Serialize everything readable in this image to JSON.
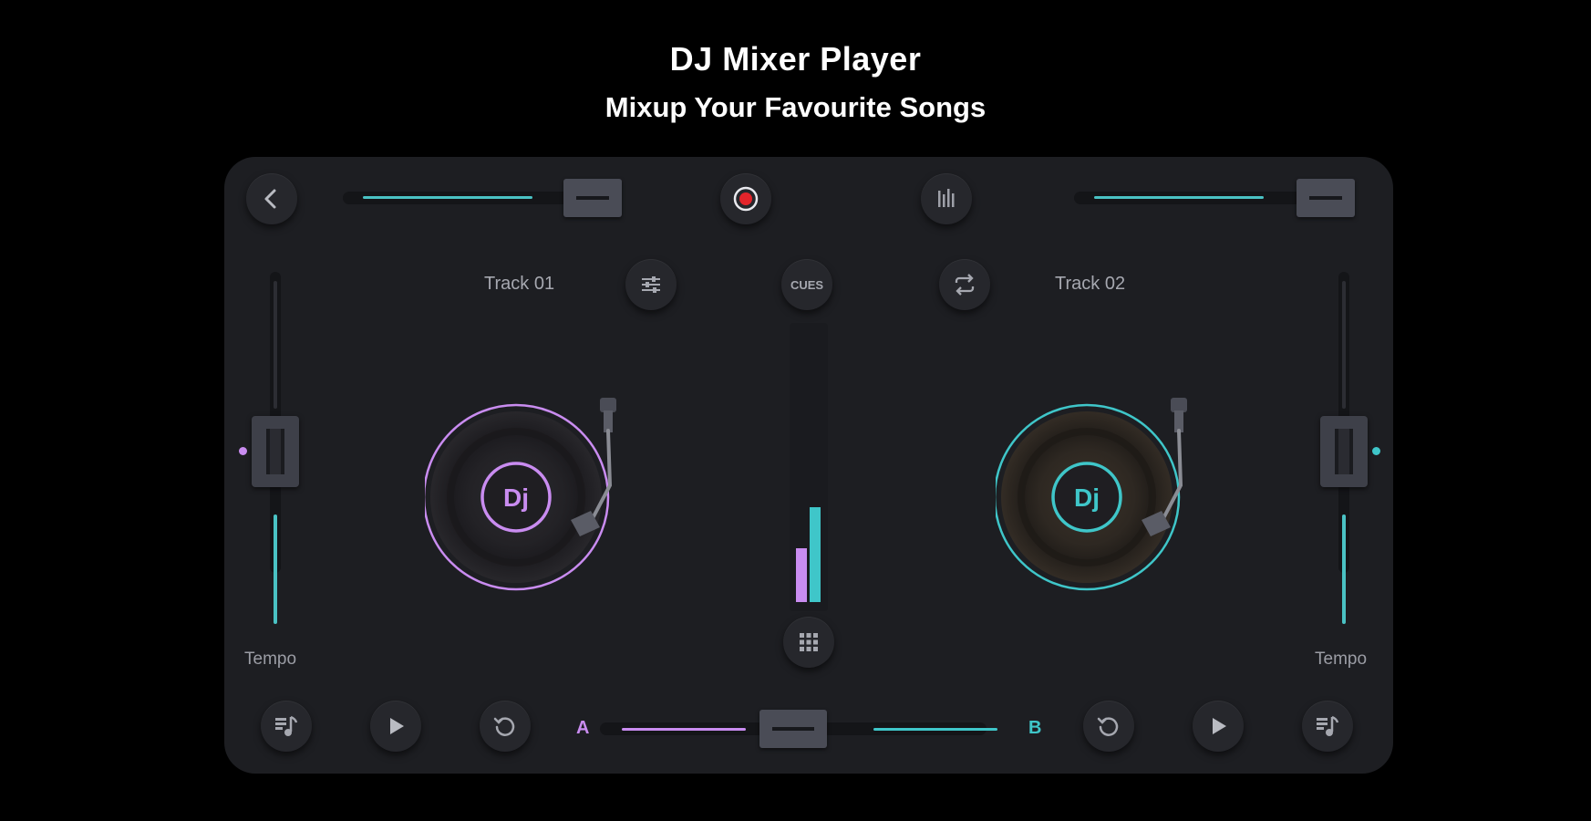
{
  "header": {
    "title": "DJ Mixer Player",
    "subtitle": "Mixup Your Favourite Songs"
  },
  "colors": {
    "deck_a": "#c98cf0",
    "deck_b": "#3fc6c9",
    "record": "#e3242b",
    "panel": "#1d1e22"
  },
  "top_bar": {
    "back_icon": "chevron-left-icon",
    "record_icon": "record-icon",
    "equalizer_icon": "equalizer-bars-icon"
  },
  "deck_a": {
    "track_name": "Track 01",
    "tempo_label": "Tempo",
    "vinyl_label": "Dj",
    "settings_icon": "sliders-icon"
  },
  "deck_b": {
    "track_name": "Track 02",
    "tempo_label": "Tempo",
    "vinyl_label": "Dj",
    "loop_icon": "repeat-icon"
  },
  "center": {
    "cues_label": "CUES",
    "grid_icon": "grid-icon",
    "level_a": 0.2,
    "level_b": 0.35
  },
  "crossfader": {
    "left_label": "A",
    "right_label": "B",
    "position": 0.5
  },
  "bottom_bar": {
    "music_icon": "music-note-icon",
    "play_icon": "play-icon",
    "reset_icon": "reset-icon"
  }
}
